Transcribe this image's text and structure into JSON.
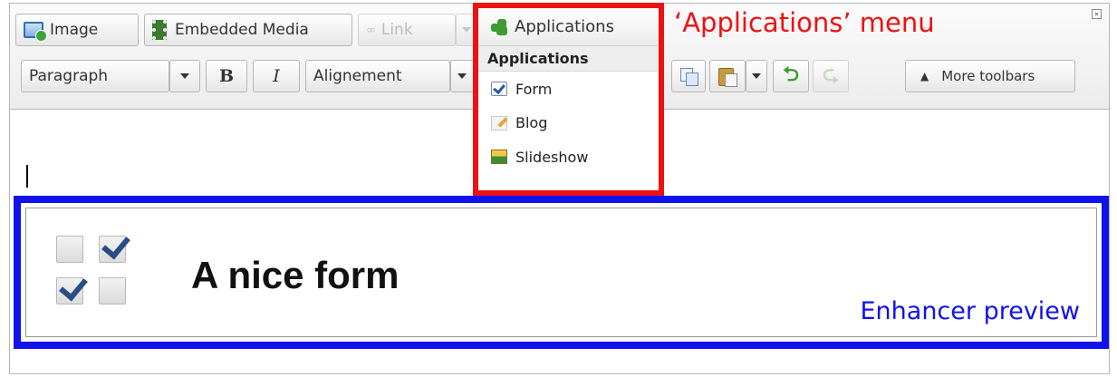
{
  "toolbar_row1": {
    "image_label": "Image",
    "embedded_media_label": "Embedded Media",
    "link_label": "Link",
    "applications_label": "Applications"
  },
  "toolbar_row2": {
    "paragraph_label": "Paragraph",
    "bold_label": "B",
    "italic_label": "I",
    "alignment_label": "Alignement",
    "more_toolbars_label": "More toolbars"
  },
  "applications_menu": {
    "header": "Applications",
    "items": [
      {
        "label": "Form",
        "icon": "form-check-icon"
      },
      {
        "label": "Blog",
        "icon": "blog-pencil-icon"
      },
      {
        "label": "Slideshow",
        "icon": "slideshow-picture-icon"
      }
    ]
  },
  "annotations": {
    "applications_menu": "‘Applications’ menu",
    "enhancer_preview": "Enhancer preview"
  },
  "preview": {
    "title": "A nice form"
  },
  "colors": {
    "annotation_red": "#ee1111",
    "annotation_blue": "#1111ee",
    "undo_green": "#3d9a2c",
    "checkmark_navy": "#2a4d83"
  }
}
